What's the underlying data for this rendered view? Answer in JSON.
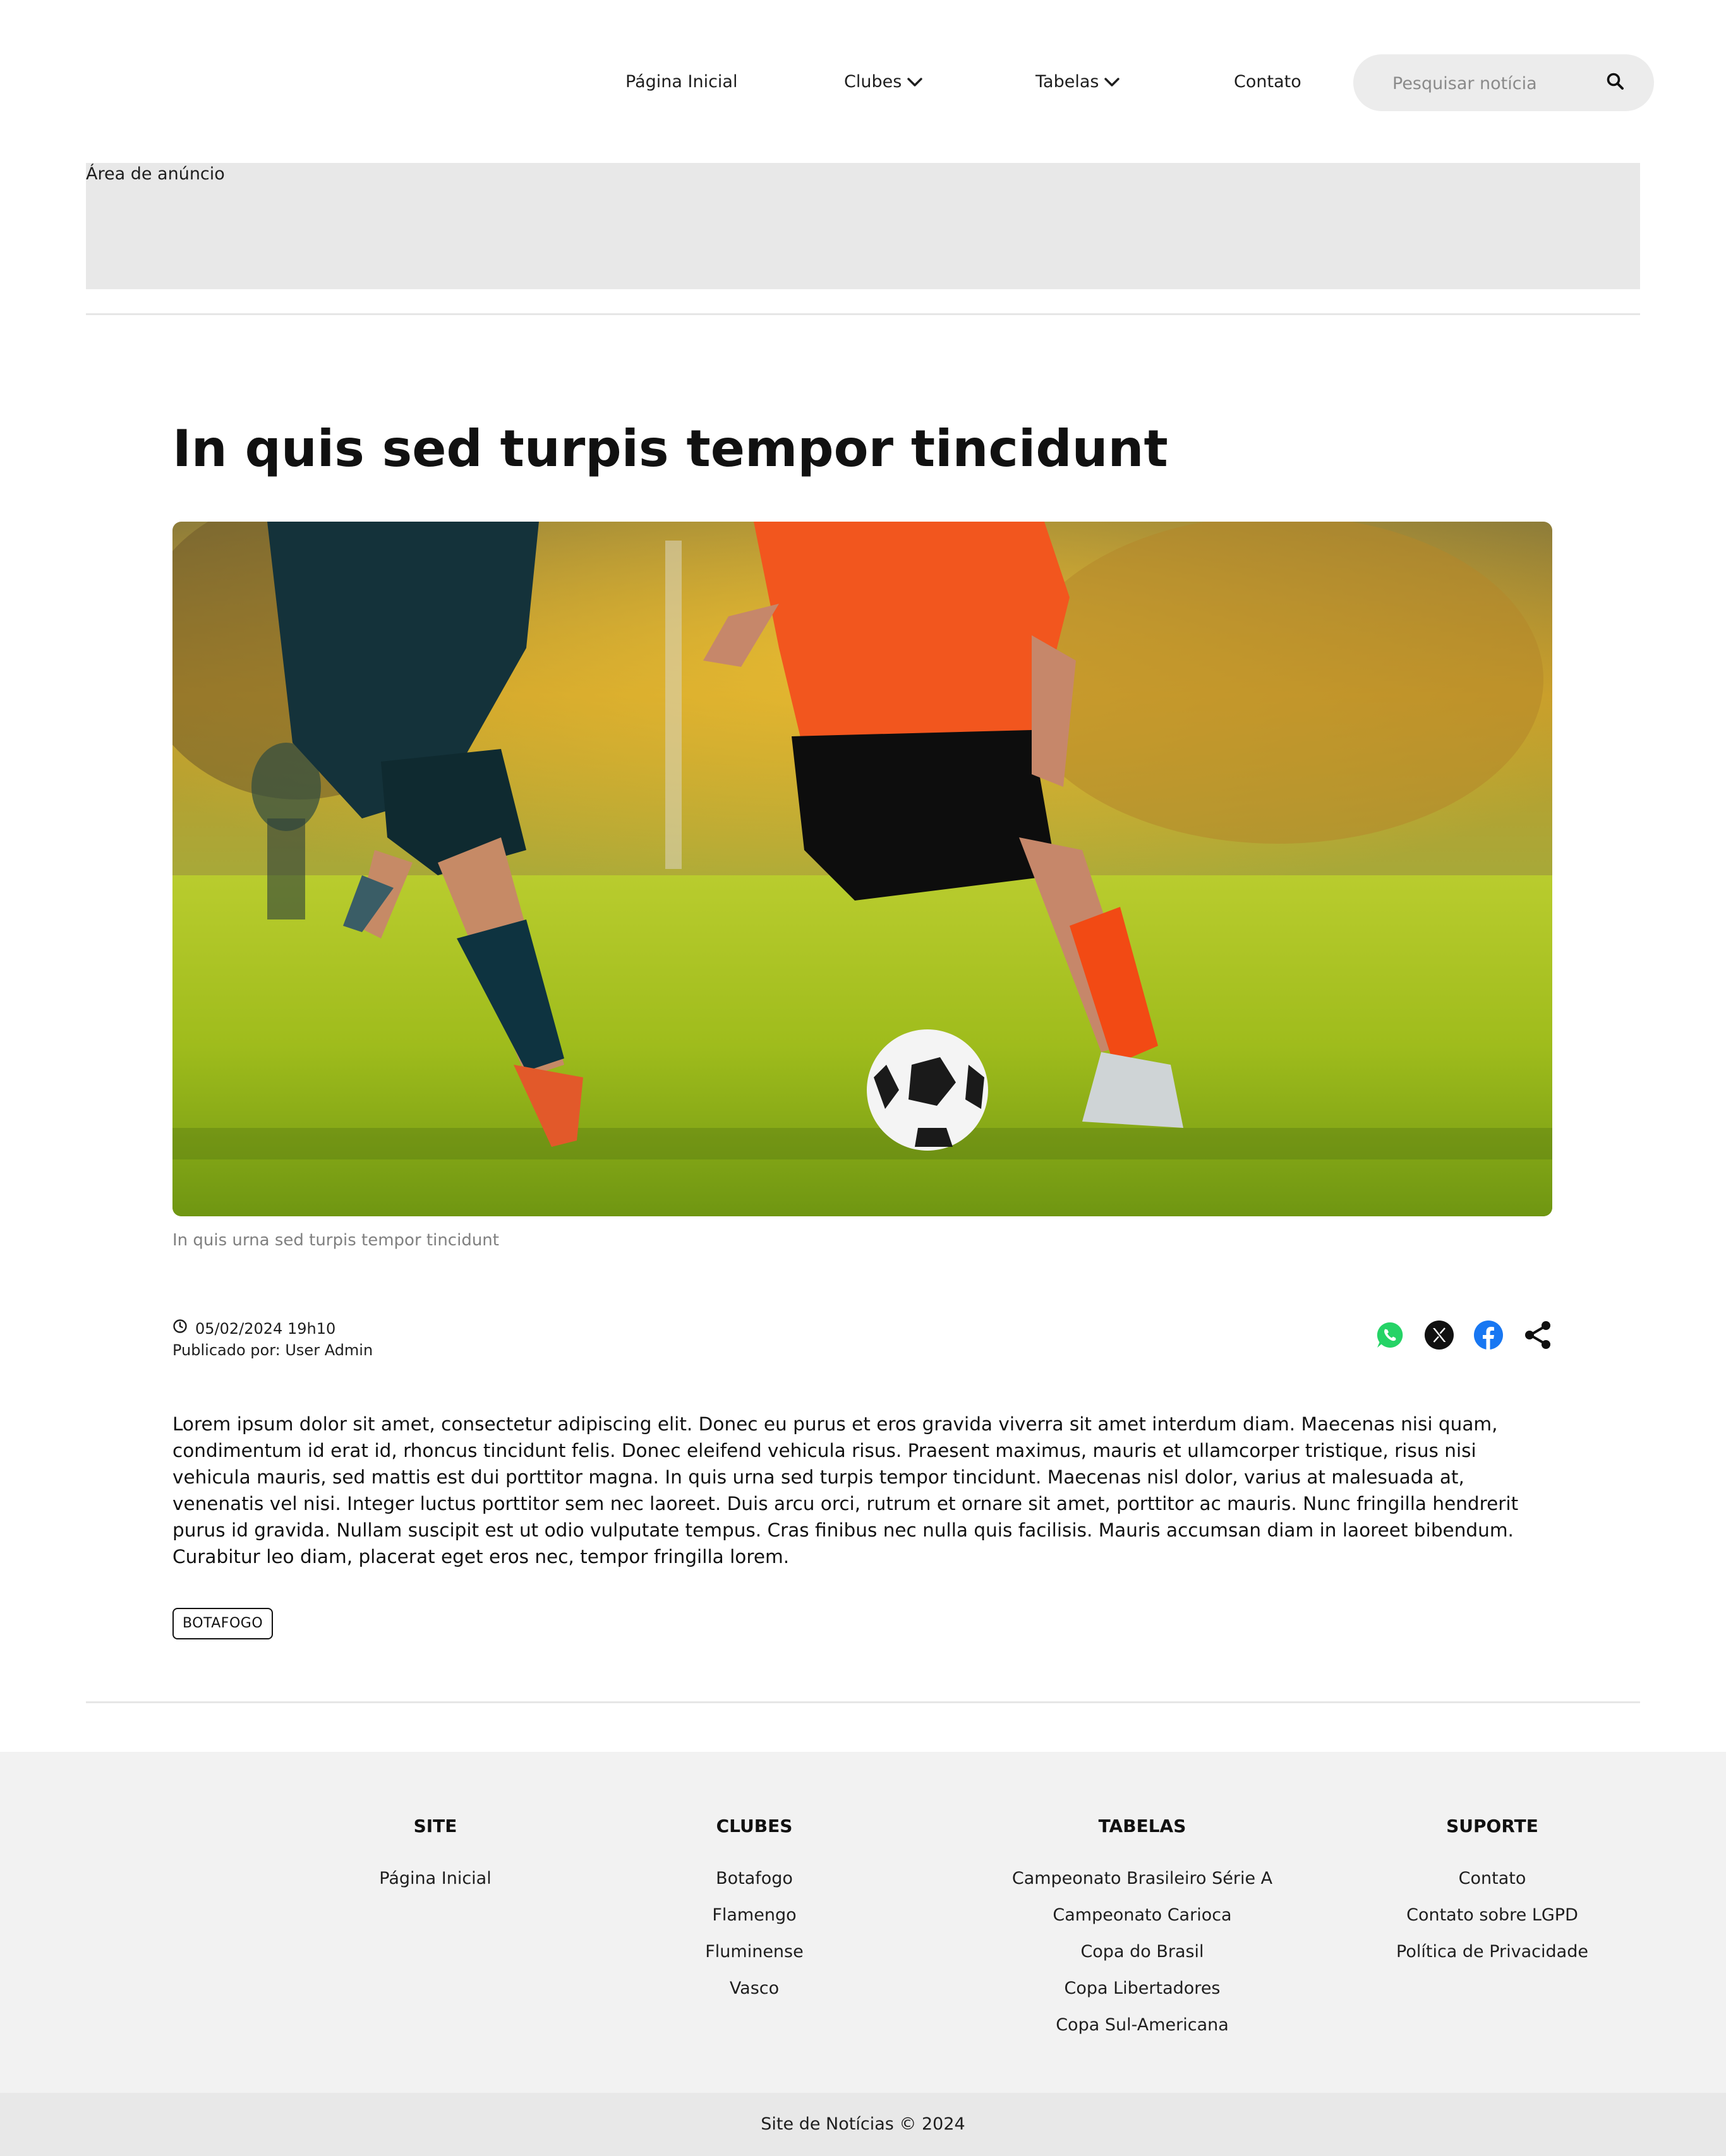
{
  "nav": {
    "home": "Página Inicial",
    "clubs": "Clubes",
    "tables": "Tabelas",
    "contact": "Contato"
  },
  "search": {
    "placeholder": "Pesquisar notícia"
  },
  "ad": {
    "label": "Área de anúncio"
  },
  "article": {
    "title": "In quis sed turpis tempor tincidunt",
    "image_caption": "In quis urna sed turpis tempor tincidunt",
    "date": "05/02/2024 19h10",
    "author": "Publicado por: User Admin",
    "body": "Lorem ipsum dolor sit amet, consectetur adipiscing elit. Donec eu purus et eros gravida viverra sit amet interdum diam. Maecenas nisi quam, condimentum id erat id, rhoncus tincidunt felis. Donec eleifend vehicula risus. Praesent maximus, mauris et ullamcorper tristique, risus nisi vehicula mauris, sed mattis est dui porttitor magna. In quis urna sed turpis tempor tincidunt. Maecenas nisl dolor, varius at malesuada at, venenatis vel nisi. Integer luctus porttitor sem nec laoreet. Duis arcu orci, rutrum et ornare sit amet, porttitor ac mauris. Nunc fringilla hendrerit purus id gravida. Nullam suscipit est ut odio vulputate tempus. Cras finibus nec nulla quis facilisis. Mauris accumsan diam in laoreet bibendum. Curabitur leo diam, placerat eget eros nec, tempor fringilla lorem.",
    "tag": "BOTAFOGO",
    "share_icons": [
      "whatsapp-icon",
      "x-icon",
      "facebook-icon",
      "share-icon"
    ]
  },
  "footer": {
    "site": {
      "heading": "SITE",
      "links": [
        "Página Inicial"
      ]
    },
    "clubs": {
      "heading": "CLUBES",
      "links": [
        "Botafogo",
        "Flamengo",
        "Fluminense",
        "Vasco"
      ]
    },
    "tables": {
      "heading": "TABELAS",
      "links": [
        "Campeonato Brasileiro Série A",
        "Campeonato Carioca",
        "Copa do Brasil",
        "Copa Libertadores",
        "Copa Sul-Americana"
      ]
    },
    "support": {
      "heading": "SUPORTE",
      "links": [
        "Contato",
        "Contato sobre LGPD",
        "Política de Privacidade"
      ]
    },
    "copyright": "Site de Notícias © 2024"
  },
  "colors": {
    "whatsapp": "#25d366",
    "facebook": "#1877f2",
    "ad_background": "#e8e8e8",
    "footer_background": "#f2f2f2"
  }
}
